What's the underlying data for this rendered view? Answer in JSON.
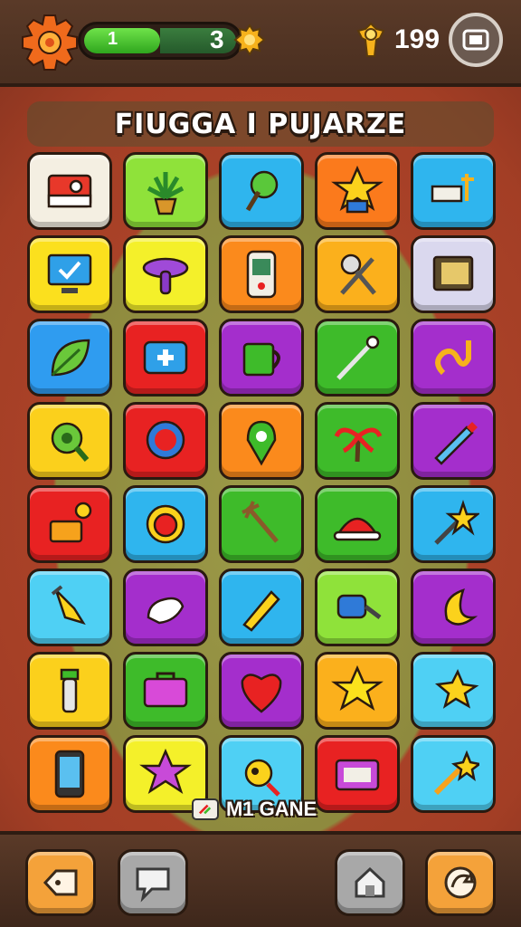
{
  "header": {
    "energy_label": "1",
    "energy_level": 0.5,
    "lives_count": "3",
    "coins": "199",
    "icons": [
      "settings-gear-icon",
      "energy-bar",
      "lives-icon",
      "coin-icon",
      "menu-icon"
    ]
  },
  "title": "FIUGGA I PUJARZE",
  "grid": {
    "rows": 8,
    "cols": 5,
    "tiles": [
      {
        "icon": "camera-icon",
        "color": "#f4efe2"
      },
      {
        "icon": "potted-plant-icon",
        "color": "#8fe23a"
      },
      {
        "icon": "tree-icon",
        "color": "#2fb5ee"
      },
      {
        "icon": "star-character-icon",
        "color": "#fb7a1c"
      },
      {
        "icon": "sign-post-icon",
        "color": "#2fb5ee"
      },
      {
        "icon": "monitor-check-icon",
        "color": "#fbe01e"
      },
      {
        "icon": "mushroom-icon",
        "color": "#f4f02a"
      },
      {
        "icon": "game-device-icon",
        "color": "#fb8a1c"
      },
      {
        "icon": "racket-icon",
        "color": "#fbb01c"
      },
      {
        "icon": "document-icon",
        "color": "#dad8ee"
      },
      {
        "icon": "leaf-icon",
        "color": "#2f9cf0"
      },
      {
        "icon": "first-aid-icon",
        "color": "#e82222"
      },
      {
        "icon": "mug-icon",
        "color": "#a42ecc"
      },
      {
        "icon": "pin-icon",
        "color": "#3ebb2a"
      },
      {
        "icon": "hook-icon",
        "color": "#a42ecc"
      },
      {
        "icon": "seed-icon",
        "color": "#fbd01c"
      },
      {
        "icon": "chat-bubble-icon",
        "color": "#e82222"
      },
      {
        "icon": "map-pin-icon",
        "color": "#fb8a1c"
      },
      {
        "icon": "palm-tree-icon",
        "color": "#3ebb2a"
      },
      {
        "icon": "pencil-icon",
        "color": "#a42ecc"
      },
      {
        "icon": "flower-box-icon",
        "color": "#e82222"
      },
      {
        "icon": "sunflower-icon",
        "color": "#2fb5ee"
      },
      {
        "icon": "rake-icon",
        "color": "#3ebb2a"
      },
      {
        "icon": "hat-icon",
        "color": "#3ebb2a"
      },
      {
        "icon": "star-wand-icon",
        "color": "#2fb5ee"
      },
      {
        "icon": "cone-icon",
        "color": "#4fd0f4"
      },
      {
        "icon": "glove-icon",
        "color": "#a42ecc"
      },
      {
        "icon": "crayon-icon",
        "color": "#2fb5ee"
      },
      {
        "icon": "roller-icon",
        "color": "#8fe23a"
      },
      {
        "icon": "moon-icon",
        "color": "#a42ecc"
      },
      {
        "icon": "bottle-icon",
        "color": "#fbd01c"
      },
      {
        "icon": "bag-icon",
        "color": "#3ebb2a"
      },
      {
        "icon": "heart-icon",
        "color": "#a42ecc"
      },
      {
        "icon": "star-icon",
        "color": "#fbb01c"
      },
      {
        "icon": "shooting-star-icon",
        "color": "#4fd0f4"
      },
      {
        "icon": "phone-icon",
        "color": "#fb8a1c"
      },
      {
        "icon": "star-gem-icon",
        "color": "#f4f02a"
      },
      {
        "icon": "bird-icon",
        "color": "#4fd0f4"
      },
      {
        "icon": "briefcase-icon",
        "color": "#e82222"
      },
      {
        "icon": "magic-wand-icon",
        "color": "#4fd0f4"
      }
    ]
  },
  "mini_game": {
    "label": "M1 GANE",
    "icon": "mini-game-icon"
  },
  "footer": {
    "buttons": [
      {
        "icon": "back-tag-icon",
        "color": "#f4a23a"
      },
      {
        "icon": "speech-icon",
        "color": "#a8a8a8"
      },
      {
        "icon": "home-icon",
        "color": "#a8a8a8"
      },
      {
        "icon": "refresh-icon",
        "color": "#f4a23a"
      }
    ]
  }
}
